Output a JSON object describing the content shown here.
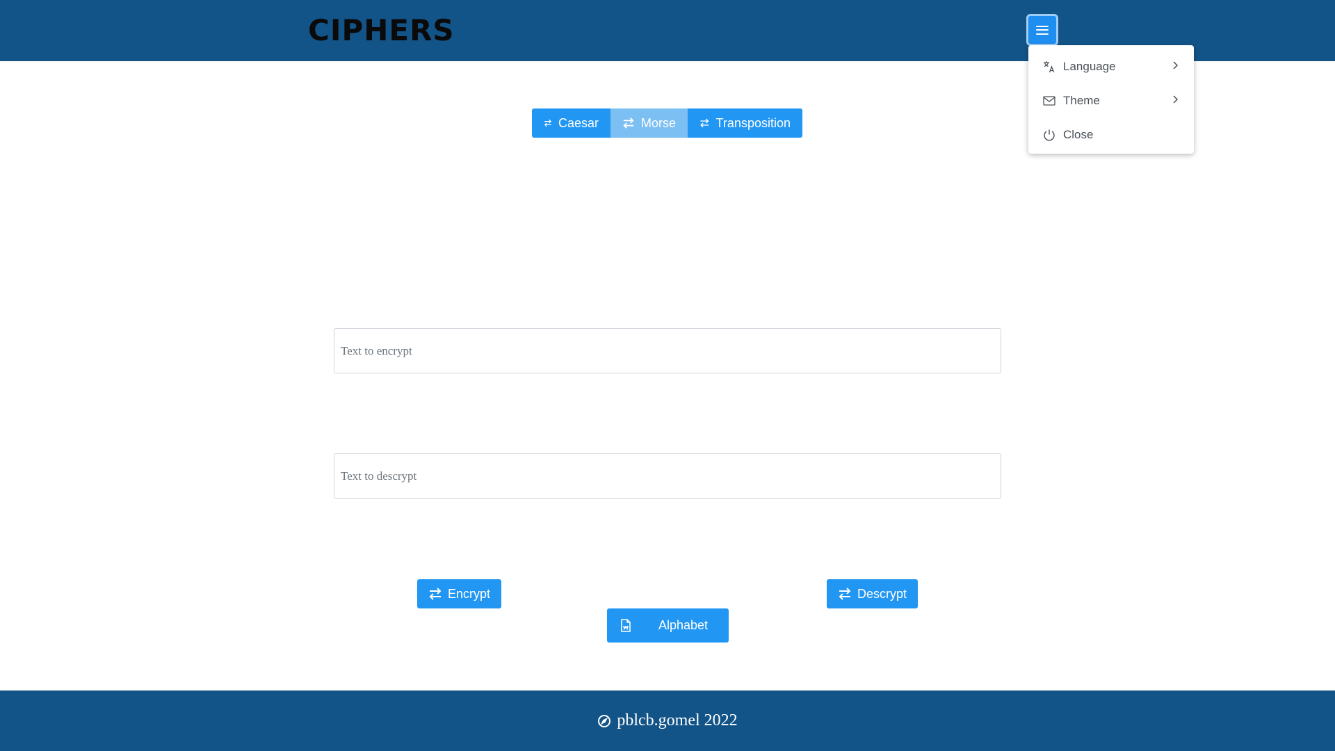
{
  "app": {
    "title": "CIPHERS"
  },
  "header": {
    "menu_icon": "hamburger-menu-icon"
  },
  "menu": {
    "items": [
      {
        "label": "Language",
        "icon": "translate-icon",
        "has_submenu": true
      },
      {
        "label": "Theme",
        "icon": "envelope-icon",
        "has_submenu": true
      },
      {
        "label": "Close",
        "icon": "power-icon",
        "has_submenu": false
      }
    ]
  },
  "tabs": [
    {
      "label": "Caesar",
      "icon": "swap-arrows-icon",
      "active": false
    },
    {
      "label": "Morse",
      "icon": "swap-arrows-icon",
      "active": true
    },
    {
      "label": "Transposition",
      "icon": "swap-arrows-icon",
      "active": false
    }
  ],
  "form": {
    "encrypt_input": {
      "placeholder": "Text to encrypt",
      "value": ""
    },
    "decrypt_input": {
      "placeholder": "Text to descrypt",
      "value": ""
    }
  },
  "actions": {
    "encrypt_label": "Encrypt",
    "decrypt_label": "Descrypt",
    "alphabet_label": "Alphabet",
    "alphabet_icon": "document-icon"
  },
  "footer": {
    "text": "pblcb.gomel 2022",
    "icon": "compass-icon"
  },
  "colors": {
    "header_bg": "#135488",
    "primary": "#2196f3",
    "active_tab": "#7cbff3",
    "menu_button": "#1f8ef1"
  }
}
